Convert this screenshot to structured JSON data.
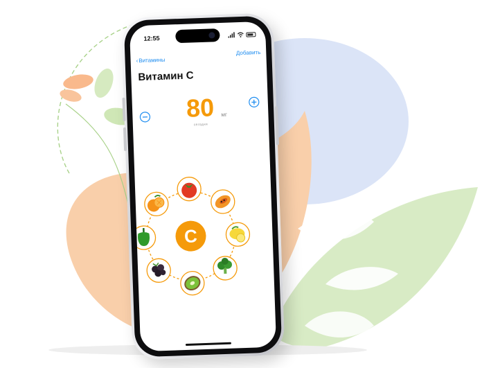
{
  "status_bar": {
    "time": "12:55"
  },
  "nav": {
    "back_label": "Витамины",
    "add_label": "Добавить"
  },
  "page": {
    "title": "Витамин С"
  },
  "dose": {
    "amount": "80",
    "unit": "мг",
    "caption": "сегодня"
  },
  "center": {
    "letter": "C"
  },
  "foods": [
    {
      "name": "tomato-icon"
    },
    {
      "name": "papaya-icon"
    },
    {
      "name": "lemon-icon"
    },
    {
      "name": "broccoli-icon"
    },
    {
      "name": "kiwi-icon"
    },
    {
      "name": "blackberry-icon"
    },
    {
      "name": "bell-pepper-icon"
    },
    {
      "name": "orange-icon"
    }
  ],
  "colors": {
    "accent": "#f59a0a",
    "link": "#1c8cf0",
    "leaf_green": "#cfe7b6",
    "peach": "#f9cfaa",
    "blob_blue": "#dbe4f7"
  }
}
